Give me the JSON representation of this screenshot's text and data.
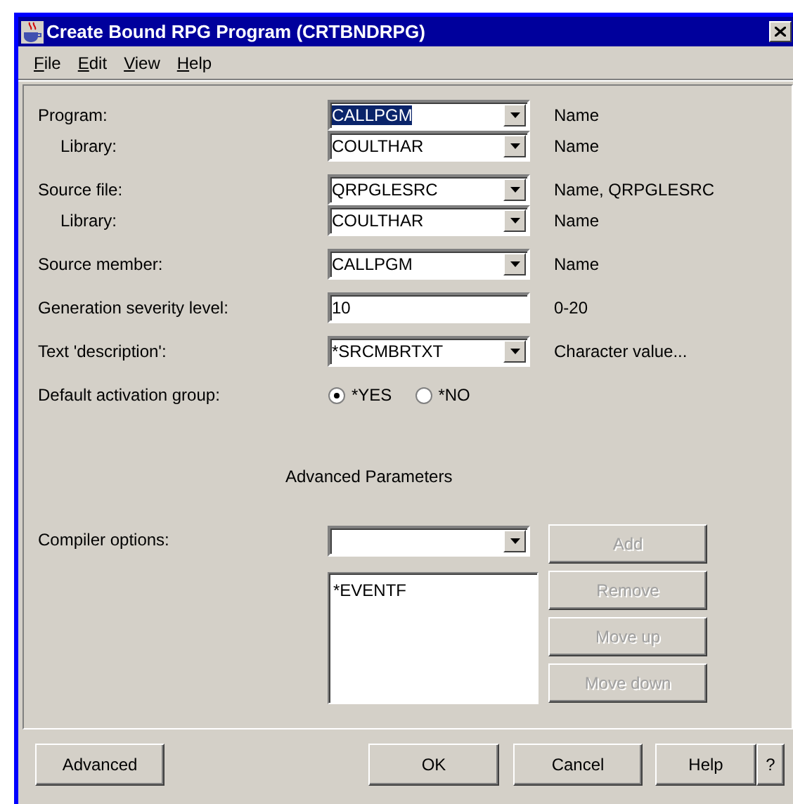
{
  "window": {
    "title": "Create Bound RPG Program (CRTBNDRPG)"
  },
  "menu": [
    "File",
    "Edit",
    "View",
    "Help"
  ],
  "parameters": [
    {
      "kind": "combo",
      "label": "Program:",
      "value": "CALLPGM",
      "highlighted": true,
      "hint": "Name",
      "children": [
        {
          "kind": "combo",
          "label": "Library:",
          "value": "COULTHAR",
          "highlighted": false,
          "hint": "Name"
        }
      ]
    },
    {
      "kind": "combo",
      "label": "Source file:",
      "value": "QRPGLESRC",
      "highlighted": false,
      "hint": "Name, QRPGLESRC",
      "children": [
        {
          "kind": "combo",
          "label": "Library:",
          "value": "COULTHAR",
          "highlighted": false,
          "hint": "Name"
        }
      ]
    },
    {
      "kind": "combo",
      "label": "Source member:",
      "value": "CALLPGM",
      "highlighted": false,
      "hint": "Name"
    },
    {
      "kind": "text",
      "label": "Generation severity level:",
      "value": "10",
      "highlighted": false,
      "hint": "0-20"
    },
    {
      "kind": "combo",
      "label": "Text 'description':",
      "value": "*SRCMBRTXT",
      "highlighted": false,
      "hint": "Character value..."
    },
    {
      "kind": "radio",
      "label": "Default activation group:",
      "options": [
        {
          "label": "*YES",
          "selected": true
        },
        {
          "label": "*NO",
          "selected": false
        }
      ]
    }
  ],
  "advanced": {
    "heading": "Advanced Parameters",
    "label": "Compiler options:",
    "list": [
      "*EVENTF"
    ],
    "buttons": [
      {
        "label": "Add",
        "disabled": true
      },
      {
        "label": "Remove",
        "disabled": true
      },
      {
        "label": "Move up",
        "disabled": true
      },
      {
        "label": "Move down",
        "disabled": true
      }
    ]
  },
  "buttons": [
    "Advanced",
    "OK",
    "Cancel",
    "Help",
    "?"
  ]
}
